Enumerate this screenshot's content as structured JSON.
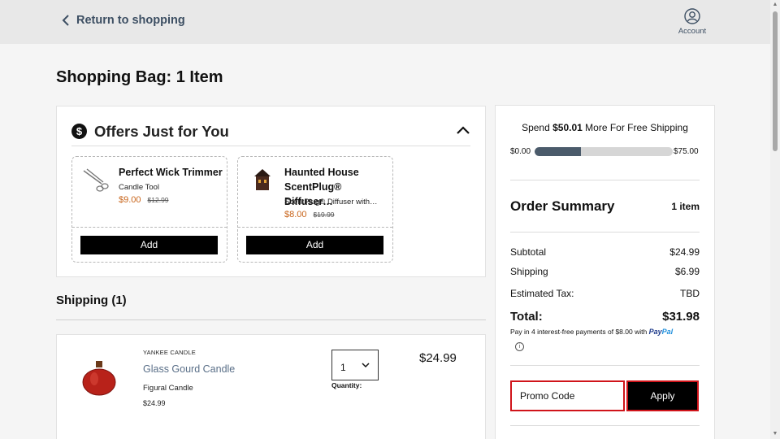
{
  "header": {
    "return_label": "Return to shopping",
    "account_label": "Account"
  },
  "page": {
    "title": "Shopping Bag: 1 Item"
  },
  "offers": {
    "title": "Offers Just for You",
    "items": [
      {
        "name": "Perfect Wick Trimmer",
        "type": "Candle Tool",
        "price": "$9.00",
        "original_price": "$12.99",
        "button_label": "Add"
      },
      {
        "name": "Haunted House ScentPlug® Diffuser…",
        "type": "ScentPlug® Diffuser with…",
        "price": "$8.00",
        "original_price": "$19.99",
        "button_label": "Add"
      }
    ]
  },
  "shipping": {
    "heading": "Shipping (1)",
    "item": {
      "brand": "YANKEE CANDLE",
      "name": "Glass Gourd Candle",
      "type": "Figural Candle",
      "unit_price": "$24.99",
      "quantity": "1",
      "quantity_label": "Quantity:",
      "price": "$24.99"
    }
  },
  "summary": {
    "free_shipping_prefix": "Spend",
    "free_shipping_amount": "$50.01",
    "free_shipping_suffix": "More For Free Shipping",
    "progress_min": "$0.00",
    "progress_max": "$75.00",
    "progress_fraction": 0.333,
    "title": "Order Summary",
    "item_count": "1 item",
    "subtotal_label": "Subtotal",
    "subtotal": "$24.99",
    "shipping_label": "Shipping",
    "shipping": "$6.99",
    "tax_label": "Estimated Tax:",
    "tax": "TBD",
    "total_label": "Total:",
    "total": "$31.98",
    "paypal_note": "Pay in 4 interest-free payments of $8.00 with",
    "paypal_brand_a": "Pay",
    "paypal_brand_b": "Pal",
    "promo_placeholder": "Promo Code",
    "apply_label": "Apply"
  },
  "colors": {
    "accent_orange": "#c8641a",
    "promo_border": "#d0141a",
    "progress_fill": "#4b5b6b",
    "link_blue_gray": "#3d4f63"
  }
}
